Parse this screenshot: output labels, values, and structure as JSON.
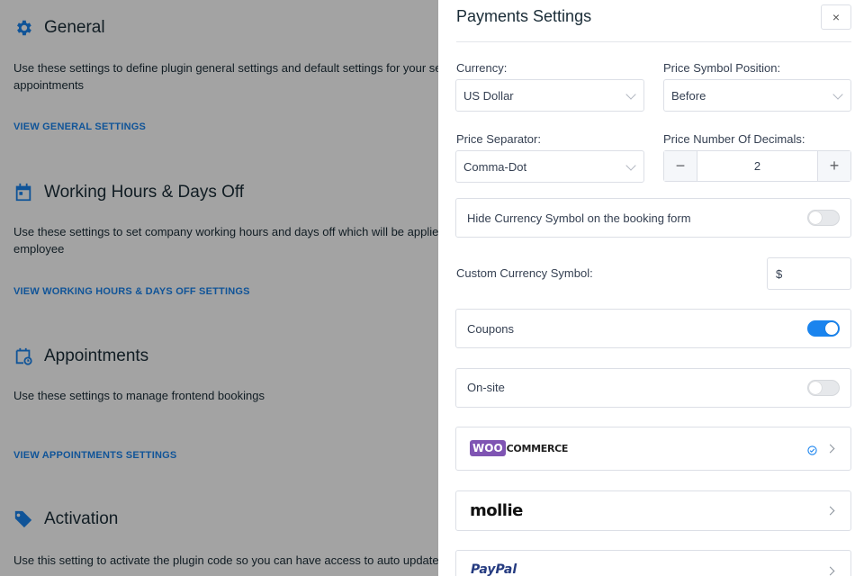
{
  "background": {
    "sections": [
      {
        "title": "General",
        "desc_line1": "Use these settings to define plugin general settings and default settings for your servi",
        "desc_line2": "appointments",
        "link": "VIEW GENERAL SETTINGS"
      },
      {
        "title": "Working Hours & Days Off",
        "desc_line1": "Use these settings to set company working hours and days off which will be applied fo",
        "desc_line2": "employee",
        "link": "VIEW WORKING HOURS & DAYS OFF SETTINGS"
      },
      {
        "title": "Appointments",
        "desc_line1": "Use these settings to manage frontend bookings",
        "desc_line2": "",
        "link": "VIEW APPOINTMENTS SETTINGS"
      },
      {
        "title": "Activation",
        "desc_line1": "Use this setting to activate the plugin code so you can have access to auto updates o",
        "desc_line2": "",
        "link": ""
      }
    ],
    "icon_color": "#1a84ee"
  },
  "dialog": {
    "title": "Payments Settings",
    "close_label": "×",
    "currency": {
      "label": "Currency:",
      "value": "US Dollar"
    },
    "symbol_position": {
      "label": "Price Symbol Position:",
      "value": "Before"
    },
    "separator": {
      "label": "Price Separator:",
      "value": "Comma-Dot"
    },
    "decimals": {
      "label": "Price Number Of Decimals:",
      "value": "2",
      "minus": "−",
      "plus": "+"
    },
    "hide_symbol": {
      "label": "Hide Currency Symbol on the booking form",
      "enabled": false
    },
    "custom_symbol": {
      "label": "Custom Currency Symbol:",
      "value": "$"
    },
    "coupons": {
      "label": "Coupons",
      "enabled": true
    },
    "onsite": {
      "label": "On-site",
      "enabled": false
    },
    "gateways": {
      "woocommerce": {
        "logo_woo": "WOO",
        "logo_commerce": "COMMERCE",
        "selected": true
      },
      "mollie": {
        "logo": "mollie"
      },
      "paypal": {
        "logo": "PayPal"
      }
    },
    "accent_color": "#1a84ee"
  }
}
